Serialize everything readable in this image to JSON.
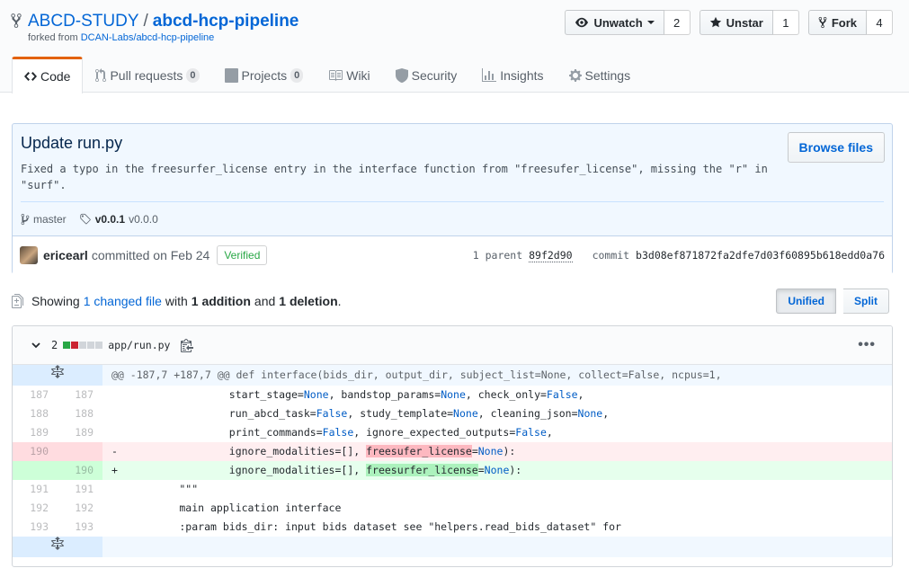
{
  "repo": {
    "owner": "ABCD-STUDY",
    "separator": "/",
    "name": "abcd-hcp-pipeline",
    "forked_prefix": "forked from",
    "forked_from": "DCAN-Labs/abcd-hcp-pipeline"
  },
  "actions": {
    "watch_label": "Unwatch",
    "watch_count": "2",
    "star_label": "Unstar",
    "star_count": "1",
    "fork_label": "Fork",
    "fork_count": "4"
  },
  "tabs": [
    {
      "label": "Code",
      "icon": "code-icon"
    },
    {
      "label": "Pull requests",
      "count": "0",
      "icon": "git-pull-request-icon"
    },
    {
      "label": "Projects",
      "count": "0",
      "icon": "project-icon"
    },
    {
      "label": "Wiki",
      "icon": "book-icon"
    },
    {
      "label": "Security",
      "icon": "shield-icon"
    },
    {
      "label": "Insights",
      "icon": "graph-icon"
    },
    {
      "label": "Settings",
      "icon": "gear-icon"
    }
  ],
  "commit": {
    "title": "Update run.py",
    "description": "Fixed a typo in the freesurfer_license entry in the interface function from \"freesufer_license\", missing the \"r\" in\n\"surf\".",
    "browse_label": "Browse files",
    "branch": "master",
    "tag": "v0.0.1",
    "tag_plain": "v0.0.0",
    "author": "ericearl",
    "committed_text": "committed on Feb 24",
    "verified": "Verified",
    "parent_label": "1 parent",
    "parent_sha": "89f2d90",
    "commit_label": "commit",
    "commit_sha": "b3d08ef871872fa2dfe7d03f60895b618edd0a76"
  },
  "toc": {
    "showing": "Showing",
    "changed_files": "1 changed file",
    "with": "with",
    "additions": "1 addition",
    "and": "and",
    "deletions": "1 deletion",
    "end": ".",
    "unified_label": "Unified",
    "split_label": "Split"
  },
  "file": {
    "change_count": "2",
    "path": "app/run.py",
    "hunk_header": "@@ -187,7 +187,7 @@ def interface(bids_dir, output_dir, subject_list=None, collect=False, ncpus=1,",
    "lines": [
      {
        "type": "ctx",
        "old": "187",
        "new": "187"
      },
      {
        "type": "ctx",
        "old": "188",
        "new": "188"
      },
      {
        "type": "ctx",
        "old": "189",
        "new": "189"
      },
      {
        "type": "del",
        "old": "190",
        "new": ""
      },
      {
        "type": "add",
        "old": "",
        "new": "190"
      },
      {
        "type": "ctx",
        "old": "191",
        "new": "191",
        "text": "        \"\"\""
      },
      {
        "type": "ctx",
        "old": "192",
        "new": "192",
        "text": "        main application interface"
      },
      {
        "type": "ctx",
        "old": "193",
        "new": "193",
        "text": "        :param bids_dir: input bids dataset see \"helpers.read_bids_dataset\" for"
      }
    ]
  },
  "colors": {
    "accent": "#e36209",
    "link": "#0366d6",
    "addition": "#28a745",
    "deletion": "#cb2431"
  }
}
